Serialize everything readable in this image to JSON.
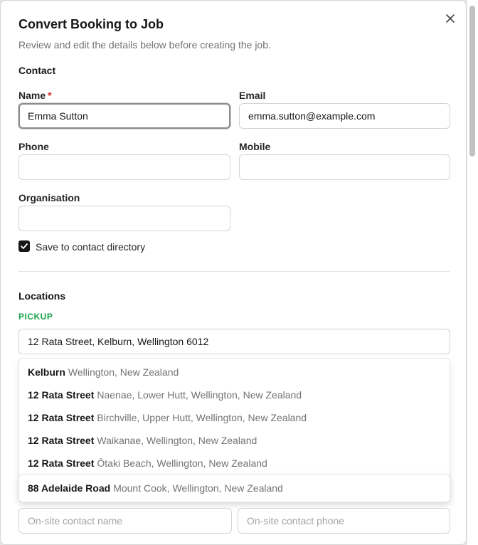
{
  "dialog": {
    "title": "Convert Booking to Job",
    "subtitle": "Review and edit the details below before creating the job."
  },
  "contact": {
    "section_title": "Contact",
    "name_label": "Name",
    "required_mark": "*",
    "name_value": "Emma Sutton",
    "email_label": "Email",
    "email_value": "emma.sutton@example.com",
    "phone_label": "Phone",
    "phone_value": "",
    "mobile_label": "Mobile",
    "mobile_value": "",
    "organisation_label": "Organisation",
    "organisation_value": "",
    "save_checkbox_label": "Save to contact directory",
    "save_checked": true
  },
  "locations": {
    "section_title": "Locations",
    "pickup_label": "PICKUP",
    "pickup_address": "12 Rata Street, Kelburn, Wellington 6012",
    "suggestions": [
      {
        "main": "Kelburn",
        "secondary": "Wellington, New Zealand"
      },
      {
        "main": "12 Rata Street",
        "secondary": "Naenae, Lower Hutt, Wellington, New Zealand"
      },
      {
        "main": "12 Rata Street",
        "secondary": "Birchville, Upper Hutt, Wellington, New Zealand"
      },
      {
        "main": "12 Rata Street",
        "secondary": "Waikanae, Wellington, New Zealand"
      },
      {
        "main": "12 Rata Street",
        "secondary": "Ōtaki Beach, Wellington, New Zealand"
      }
    ],
    "overlay_suggestion": {
      "main": "88 Adelaide Road",
      "secondary": "Mount Cook, Wellington, New Zealand"
    },
    "onsite_contact_name_placeholder": "On-site contact name",
    "onsite_contact_phone_placeholder": "On-site contact phone"
  },
  "icons": {
    "close": "close-icon",
    "check": "check-icon"
  },
  "colors": {
    "pickup_accent": "#16a34a",
    "required": "#dc2626",
    "checkbox_fill": "#171717"
  }
}
